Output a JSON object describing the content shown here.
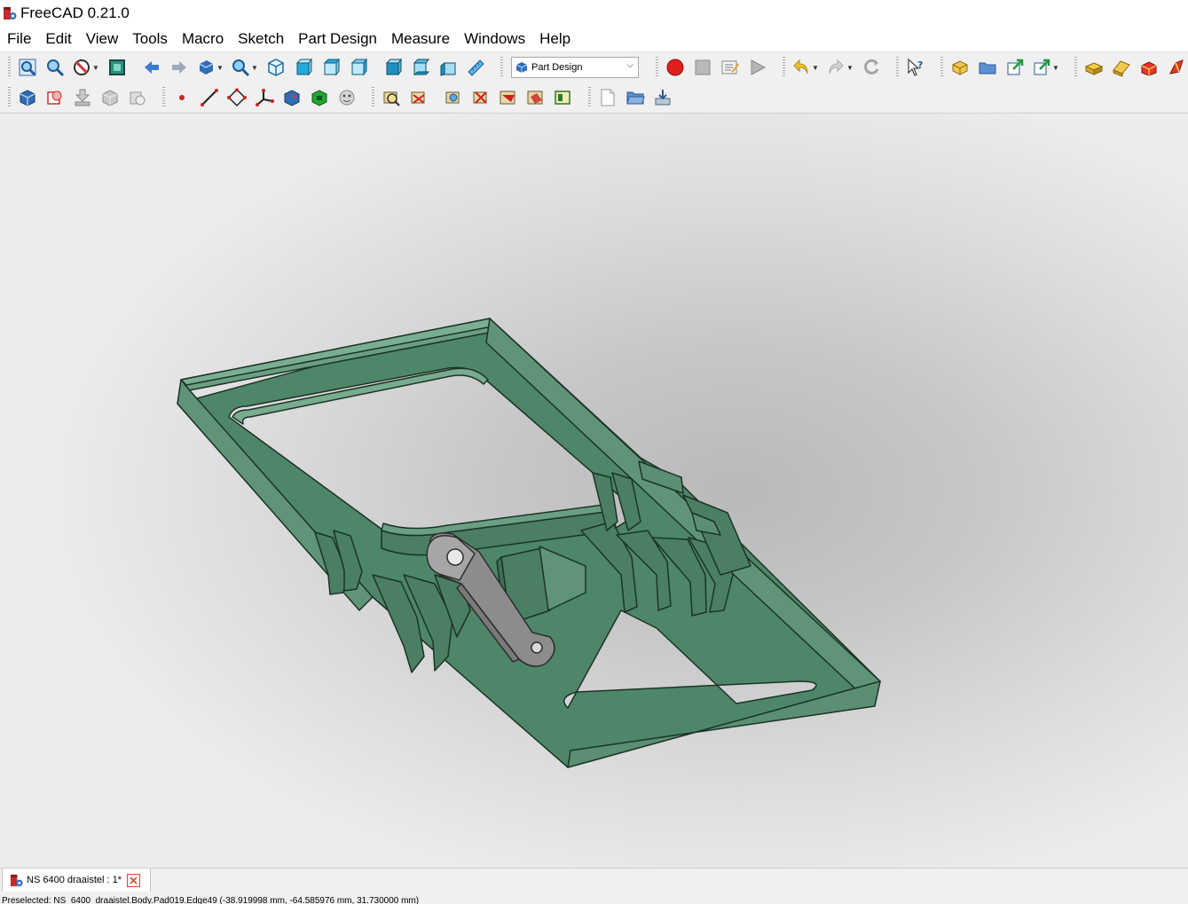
{
  "window": {
    "title": "FreeCAD 0.21.0"
  },
  "menu": [
    "File",
    "Edit",
    "View",
    "Tools",
    "Macro",
    "Sketch",
    "Part Design",
    "Measure",
    "Windows",
    "Help"
  ],
  "toolbar": {
    "workbench_selector": {
      "value": "Part Design"
    },
    "row1_icons": [
      "fit-all-icon",
      "fit-selection-icon",
      "draw-style-icon",
      "bounding-box-icon",
      "back-arrow-icon",
      "forward-arrow-icon",
      "std-views-icon",
      "zoom-icon",
      "isometric-view-icon",
      "front-view-icon",
      "top-view-icon",
      "right-view-icon",
      "rear-view-icon",
      "bottom-view-icon",
      "left-view-icon",
      "measure-distance-icon",
      "macro-record-icon",
      "macro-stop-icon",
      "macro-edit-icon",
      "macro-run-icon",
      "undo-icon",
      "redo-icon",
      "refresh-icon",
      "whats-this-icon",
      "create-part-icon",
      "create-group-icon",
      "make-link-icon",
      "link-actions-icon",
      "part-box-icon",
      "part-extrude-icon",
      "part-cube-icon",
      "part-revolve-icon"
    ],
    "row2_icons": [
      "body-icon",
      "create-clone-icon",
      "shape-binder-icon",
      "subshape-binder-icon",
      "clone-icon",
      "datum-point-icon",
      "datum-line-icon",
      "datum-plane-icon",
      "local-cs-icon",
      "pad-icon",
      "pocket-icon",
      "fillet-icon",
      "sketch-validate-icon",
      "sketch-map-icon",
      "sketch-reorient-icon",
      "sketch-edit-icon",
      "sketch-close-icon",
      "sketch-view-icon",
      "sketch-merge-icon",
      "new-document-icon",
      "open-document-icon",
      "save-document-icon"
    ]
  },
  "document_tab": {
    "label": "NS 6400 draaistel : 1*"
  },
  "status": {
    "text": "Preselected: NS_6400_draaistel.Body.Pad019.Edge49 (-38.919998 mm, -64.585976 mm, 31.730000 mm)"
  },
  "colors": {
    "model_face": "#4d8668",
    "model_edge": "#1c3327",
    "link_part": "#8c8c8c",
    "accent_red": "#e01f1f"
  }
}
